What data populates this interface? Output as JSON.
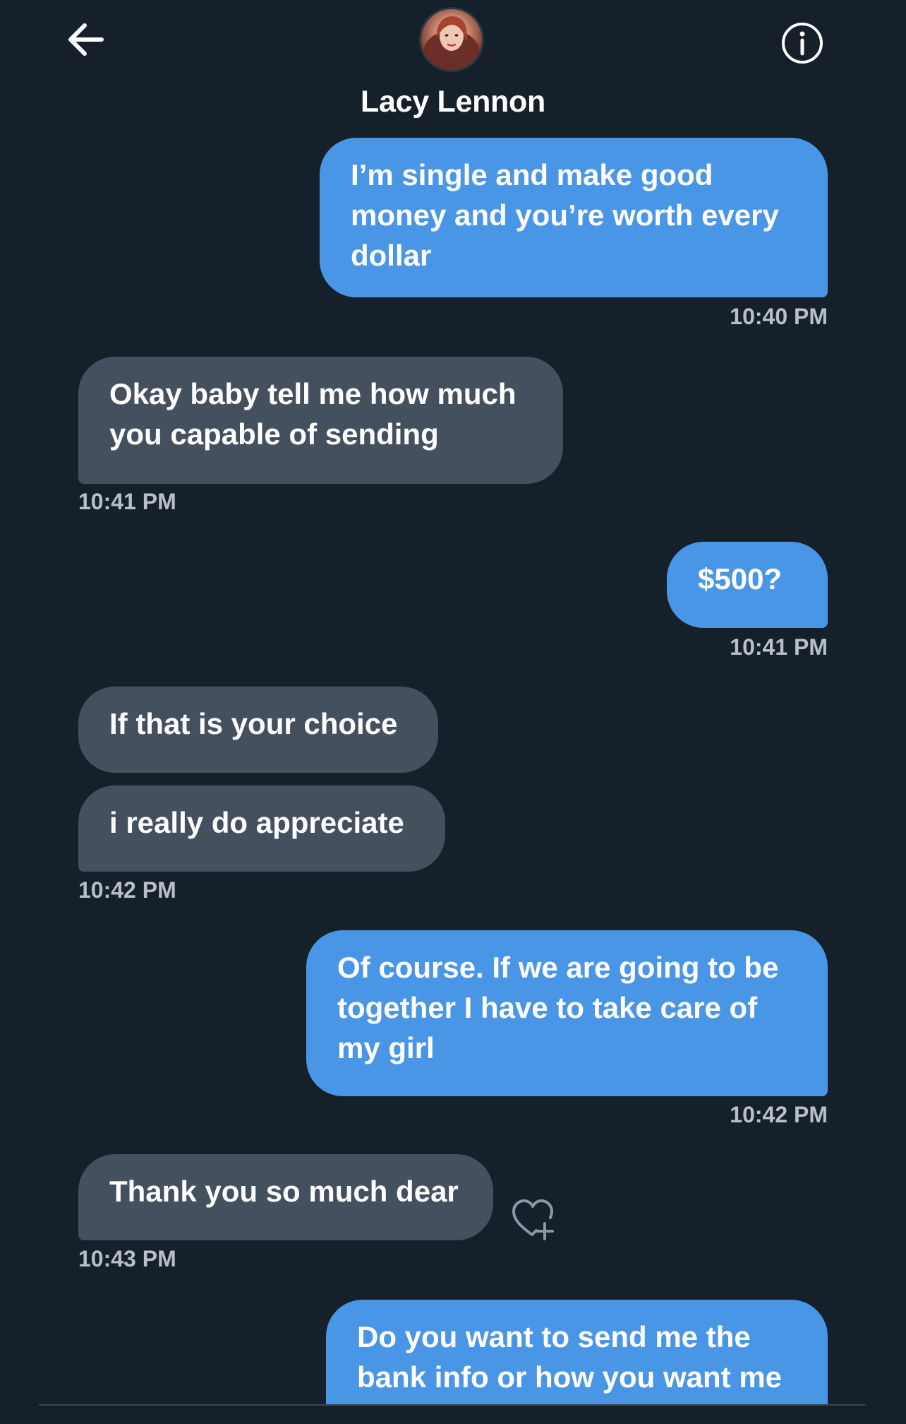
{
  "header": {
    "contact_name": "Lacy Lennon"
  },
  "icons": {
    "back": "arrow-left-icon",
    "info": "info-icon",
    "react": "heart-plus-icon"
  },
  "colors": {
    "background": "#15202b",
    "outgoing_bubble": "#4a96e6",
    "incoming_bubble": "#45505e"
  },
  "messages": [
    {
      "direction": "outgoing",
      "text": "I’m single and make good\nmoney and you’re worth every\ndollar"
    },
    {
      "direction": "incoming",
      "text": "Okay baby tell me how much\nyou capable of sending"
    },
    {
      "direction": "outgoing",
      "text": "$500?"
    },
    {
      "direction": "incoming",
      "text": "If that is your choice"
    },
    {
      "direction": "incoming",
      "text": "i really do appreciate"
    },
    {
      "direction": "outgoing",
      "text": "Of course. If we are going to be\ntogether I have to take care of\nmy girl"
    },
    {
      "direction": "incoming",
      "text": "Thank you so much dear"
    },
    {
      "direction": "outgoing",
      "text": "Do you want to send me the\nbank info or how you want me"
    }
  ],
  "timestamps": [
    "10:40 PM",
    "10:41 PM",
    "10:41 PM",
    "10:42 PM",
    "10:42 PM",
    "10:43 PM"
  ]
}
